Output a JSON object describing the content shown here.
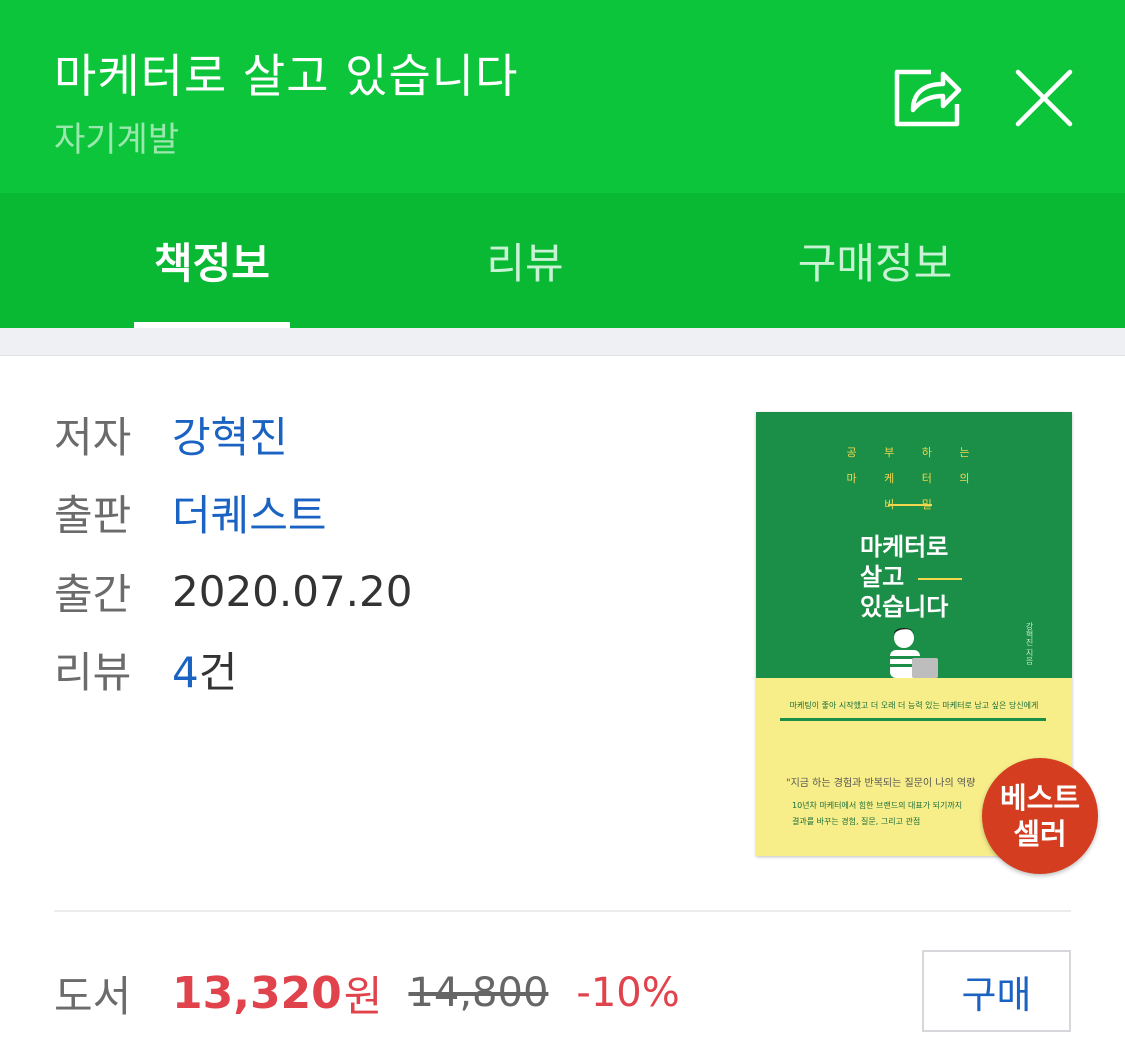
{
  "header": {
    "title": "마케터로 살고 있습니다",
    "category": "자기계발",
    "share_icon": "share-icon",
    "close_icon": "close-icon",
    "bg_color": "#0cc53a"
  },
  "tabs": [
    {
      "label": "책정보",
      "active": true
    },
    {
      "label": "리뷰",
      "active": false
    },
    {
      "label": "구매정보",
      "active": false
    }
  ],
  "info": {
    "author_label": "저자",
    "author": "강혁진",
    "publisher_label": "출판",
    "publisher": "더퀘스트",
    "date_label": "출간",
    "date": "2020.07.20",
    "review_label": "리뷰",
    "review_count": "4",
    "review_unit": "건"
  },
  "cover": {
    "top_line1": "공 부 하 는",
    "top_line2": "마 케 터 의",
    "top_line3": "비 밀",
    "title_line1": "마케터로",
    "title_line2": "살고",
    "title_line3": "있습니다",
    "author": "강혁진 지음",
    "tagline": "마케팅이 좋아 시작했고 더 오래 더 능력 있는 마케터로 남고 싶은 당신에게",
    "quote": "\"지금 하는 경험과 반복되는 질문이 나의 역량",
    "text1": "10년차 마케터에서 힘한 브랜드의 대표가 되기까지",
    "text2": "결과를 바꾸는 경험, 질문, 그리고 관점",
    "top_color": "#1b8f47",
    "bottom_color": "#f7ee8a"
  },
  "badge": {
    "line1": "베스트",
    "line2": "셀러",
    "color": "#d43d1f"
  },
  "price": {
    "label": "도서",
    "sale_price": "13,320",
    "currency": "원",
    "original_price": "14,800",
    "discount": "-10%",
    "buy_label": "구매",
    "accent_color": "#e0434b"
  }
}
